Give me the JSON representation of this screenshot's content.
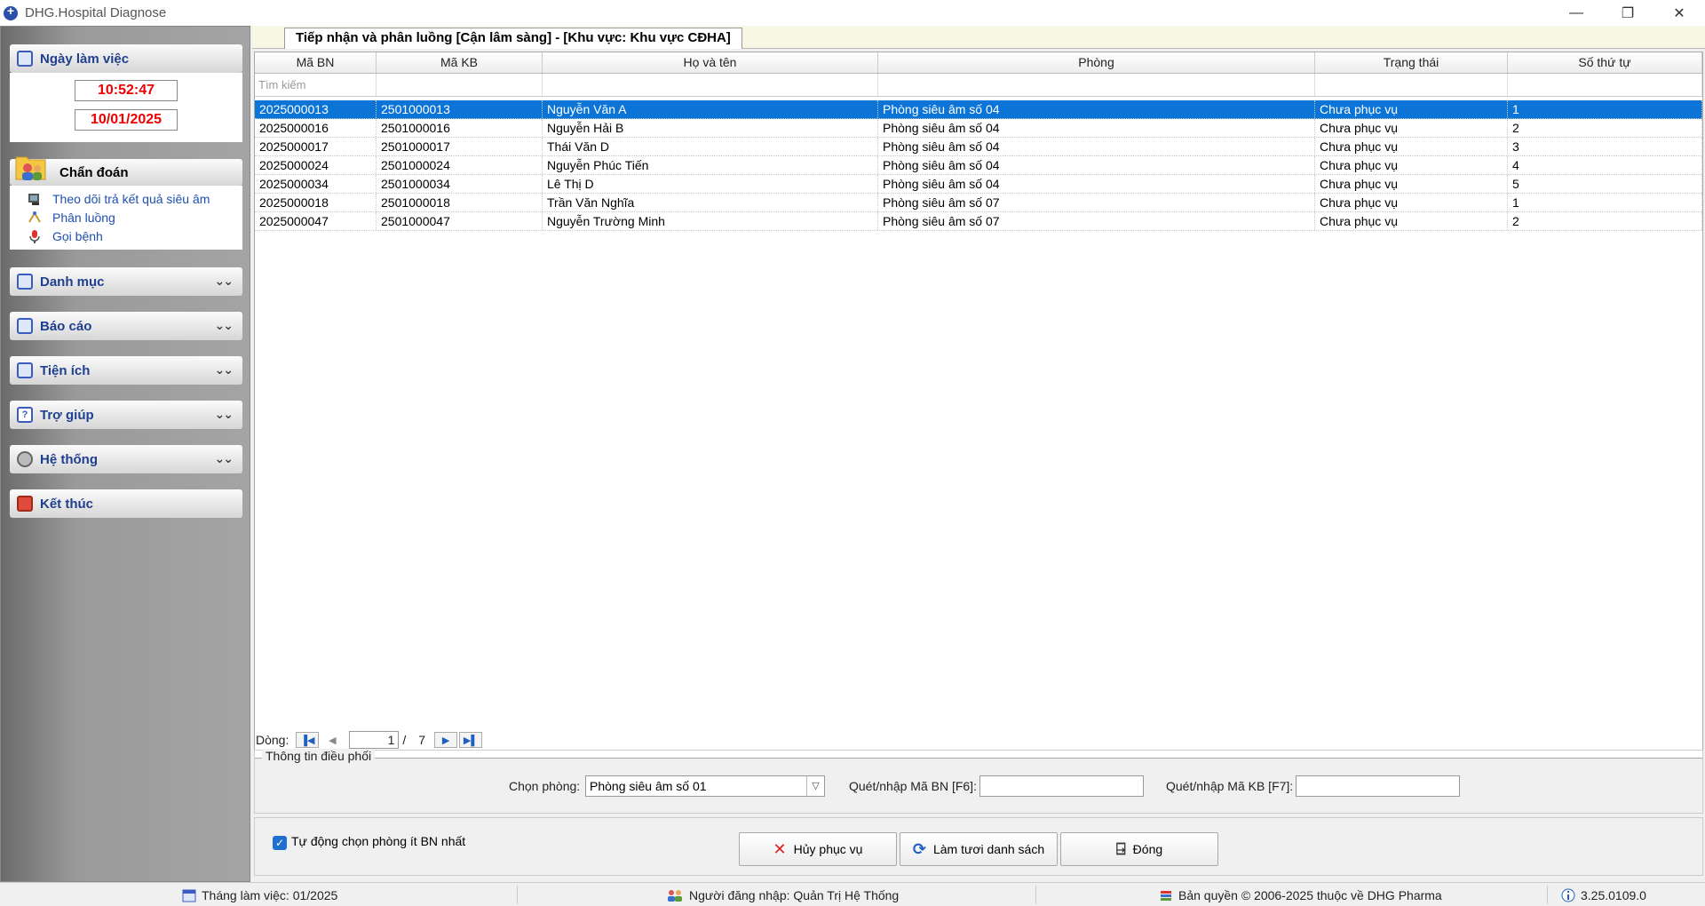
{
  "window": {
    "title": "DHG.Hospital Diagnose",
    "minimize": "—",
    "restore": "❐",
    "close": "✕"
  },
  "sidebar": {
    "working_day": {
      "title": "Ngày làm việc",
      "time": "10:52:47",
      "date": "10/01/2025"
    },
    "diagnose": {
      "title": "Chẩn đoán",
      "items": [
        {
          "label": "Theo dõi trả kết quả siêu âm"
        },
        {
          "label": "Phân luồng"
        },
        {
          "label": "Gọi bệnh"
        }
      ]
    },
    "sections": [
      {
        "label": "Danh mục"
      },
      {
        "label": "Báo cáo"
      },
      {
        "label": "Tiện ích"
      },
      {
        "label": "Trợ giúp"
      },
      {
        "label": "Hệ thống"
      },
      {
        "label": "Kết thúc"
      }
    ]
  },
  "tab": {
    "title": "Tiếp nhận và phân luồng [Cận lâm sàng] - [Khu vực: Khu vực CĐHA]"
  },
  "grid": {
    "columns": [
      "Mã BN",
      "Mã KB",
      "Họ và tên",
      "Phòng",
      "Trạng thái",
      "Số thứ tự"
    ],
    "filter_placeholder": "Tìm kiếm",
    "rows": [
      [
        "2025000013",
        "2501000013",
        "Nguyễn Văn A",
        "Phòng siêu âm số 04",
        "Chưa phục vụ",
        "1"
      ],
      [
        "2025000016",
        "2501000016",
        "Nguyễn Hải B",
        "Phòng siêu âm số 04",
        "Chưa phục vụ",
        "2"
      ],
      [
        "2025000017",
        "2501000017",
        "Thái Văn D",
        "Phòng siêu âm số 04",
        "Chưa phục vụ",
        "3"
      ],
      [
        "2025000024",
        "2501000024",
        "Nguyễn Phúc Tiến",
        "Phòng siêu âm số 04",
        "Chưa phục vụ",
        "4"
      ],
      [
        "2025000034",
        "2501000034",
        "Lê Thị D",
        "Phòng siêu âm số 04",
        "Chưa phục vụ",
        "5"
      ],
      [
        "2025000018",
        "2501000018",
        "Trần Văn Nghĩa",
        "Phòng siêu âm số 07",
        "Chưa phục vụ",
        "1"
      ],
      [
        "2025000047",
        "2501000047",
        "Nguyễn Trường Minh",
        "Phòng siêu âm số 07",
        "Chưa phục vụ",
        "2"
      ]
    ],
    "selected_row": 0
  },
  "pager": {
    "label": "Dòng:",
    "current": "1",
    "separator": "/",
    "total": "7"
  },
  "dispatch": {
    "legend": "Thông tin điều phối",
    "room_label": "Chọn phòng:",
    "room_value": "Phòng siêu âm số 01",
    "scan_bn_label": "Quét/nhập Mã BN [F6]:",
    "scan_bn_value": "",
    "scan_kb_label": "Quét/nhập Mã KB [F7]:",
    "scan_kb_value": ""
  },
  "actions": {
    "auto_select_label": "Tự động chọn phòng ít BN nhất",
    "auto_select_checked": true,
    "cancel_label": "Hủy phục vụ",
    "refresh_label": "Làm tươi danh sách",
    "close_label": "Đóng"
  },
  "status": {
    "working_month": "Tháng làm việc: 01/2025",
    "logged_user": "Người đăng nhập: Quản Trị Hệ Thống",
    "copyright": "Bản quyền © 2006-2025 thuộc về DHG Pharma",
    "version": "3.25.0109.0"
  },
  "colors": {
    "selection": "#0b74d6",
    "accent_text": "#1f3f8f",
    "date_text": "#e00000"
  }
}
